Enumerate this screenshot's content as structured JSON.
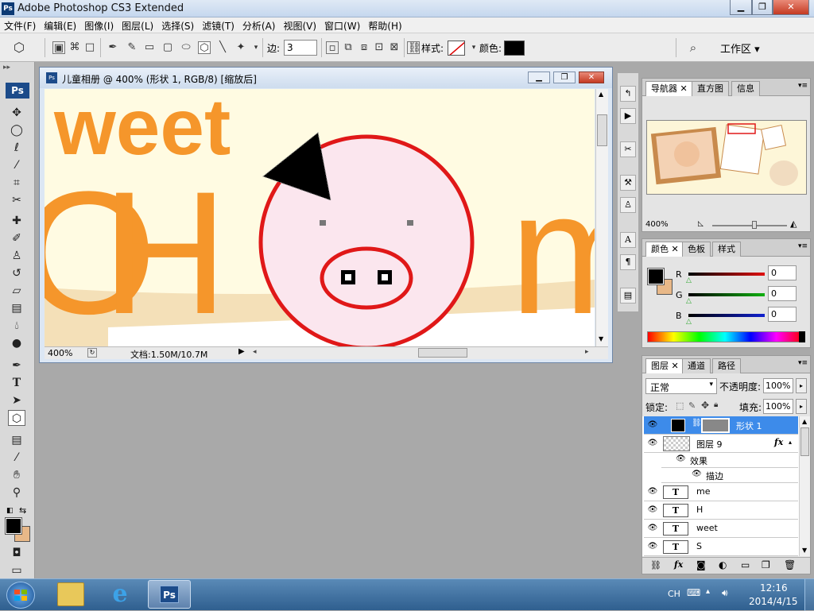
{
  "app": {
    "title": "Adobe Photoshop CS3 Extended",
    "logo": "Ps"
  },
  "window_controls": {
    "minimize": "▁",
    "restore": "❐",
    "close": "✕"
  },
  "menu": [
    "文件(F)",
    "编辑(E)",
    "图像(I)",
    "图层(L)",
    "选择(S)",
    "滤镜(T)",
    "分析(A)",
    "视图(V)",
    "窗口(W)",
    "帮助(H)"
  ],
  "options": {
    "sides_label": "边:",
    "sides_value": "3",
    "style_label": "样式:",
    "color_label": "颜色:",
    "color_value": "#000000",
    "workspace_label": "工作区 ▾"
  },
  "document": {
    "title": "儿童相册 @ 400% (形状 1, RGB/8) [缩放后]",
    "zoom": "400%",
    "doc_info": "文档:1.50M/10.7M",
    "canvas_text": {
      "weet": "weet",
      "h": "H",
      "o": "O",
      "m": "m"
    }
  },
  "navigator": {
    "tabs": [
      "导航器",
      "直方图",
      "信息"
    ],
    "zoom": "400%"
  },
  "color_panel": {
    "tabs": [
      "颜色",
      "色板",
      "样式"
    ],
    "channels": [
      {
        "label": "R",
        "value": "0",
        "color": "#e01010"
      },
      {
        "label": "G",
        "value": "0",
        "color": "#10b010"
      },
      {
        "label": "B",
        "value": "0",
        "color": "#1020d0"
      }
    ],
    "foreground": "#000000",
    "background": "#e8b888"
  },
  "layers_panel": {
    "tabs": [
      "图层",
      "通道",
      "路径"
    ],
    "blend_mode": "正常",
    "opacity_label": "不透明度:",
    "opacity_value": "100%",
    "lock_label": "锁定:",
    "fill_label": "填充:",
    "fill_value": "100%",
    "layers": [
      {
        "name": "形状 1",
        "type": "shape",
        "selected": true
      },
      {
        "name": "图层 9",
        "type": "pixel",
        "fx": "fx"
      },
      {
        "name": "效果",
        "type": "effect-group"
      },
      {
        "name": "描边",
        "type": "effect"
      },
      {
        "name": "me",
        "type": "text"
      },
      {
        "name": "H",
        "type": "text"
      },
      {
        "name": "weet",
        "type": "text"
      },
      {
        "name": "S",
        "type": "text"
      }
    ]
  },
  "taskbar": {
    "ps_label": "Ps",
    "lang": "CH",
    "time": "12:16",
    "date": "2014/4/15"
  }
}
